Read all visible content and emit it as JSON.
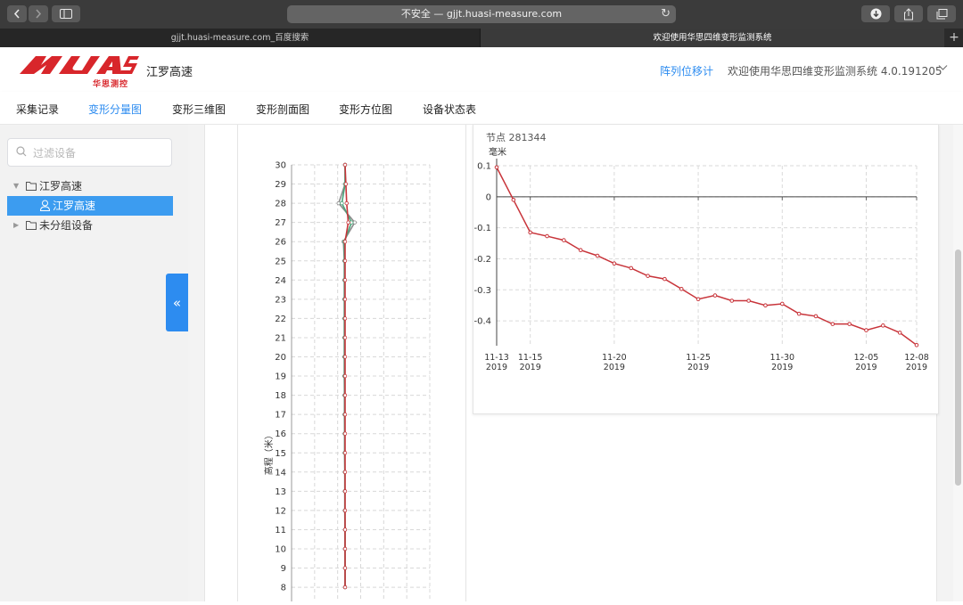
{
  "browser": {
    "address": "不安全 — gjjt.huasi-measure.com",
    "tabs": [
      "gjjt.huasi-measure.com_百度搜索",
      "欢迎使用华思四维变形监测系统"
    ]
  },
  "header": {
    "logo_text": "华思测控",
    "project": "江罗高速",
    "module": "阵列位移计",
    "welcome": "欢迎使用华思四维变形监测系统 4.0.191205"
  },
  "menu": [
    "采集记录",
    "变形分量图",
    "变形三维图",
    "变形剖面图",
    "变形方位图",
    "设备状态表"
  ],
  "menu_active": 1,
  "sidebar": {
    "search_placeholder": "过滤设备",
    "tree": [
      {
        "label": "江罗高速"
      },
      {
        "label": "江罗高速"
      },
      {
        "label": "未分组设备"
      }
    ],
    "collapse_label": "«"
  },
  "colors": {
    "accent": "#2d8cf0",
    "series": "#c8343a",
    "brand_red": "#d8262b"
  },
  "node_title": "节点 281344",
  "chart_data": [
    {
      "type": "line",
      "ylabel": "高程（米）",
      "y_ticks": [
        8,
        9,
        10,
        11,
        12,
        13,
        14,
        15,
        16,
        17,
        18,
        19,
        20,
        21,
        22,
        23,
        24,
        25,
        26,
        27,
        28,
        29,
        30
      ],
      "elevations": [
        30,
        29,
        28,
        27,
        26,
        25,
        24,
        23,
        22,
        21,
        20,
        19,
        18,
        17,
        16,
        15,
        14,
        13,
        12,
        11,
        10,
        9,
        8
      ],
      "series": [
        {
          "values": [
            0.0,
            0.0,
            -0.4,
            0.6,
            -0.1,
            -0.05,
            -0.05,
            -0.05,
            -0.05,
            -0.05,
            -0.05,
            -0.05,
            -0.04,
            -0.04,
            -0.03,
            -0.03,
            -0.02,
            -0.02,
            -0.02,
            -0.01,
            -0.01,
            0.0,
            0.0
          ]
        },
        {
          "values": [
            0.0,
            0.0,
            -0.2,
            0.4,
            -0.05,
            -0.03,
            -0.03,
            -0.03,
            -0.03,
            -0.03,
            -0.03,
            -0.03,
            -0.02,
            -0.02,
            -0.02,
            -0.02,
            -0.01,
            -0.01,
            -0.01,
            0.0,
            0.0,
            0.0,
            0.0
          ]
        },
        {
          "values": [
            0.0,
            0.05,
            0.1,
            0.2,
            0.0,
            0.0,
            0.0,
            0.0,
            0.0,
            0.0,
            0.0,
            0.0,
            0.0,
            0.0,
            0.0,
            0.0,
            0.0,
            0.0,
            0.0,
            0.0,
            0.0,
            0.0,
            0.0
          ]
        }
      ],
      "xlim": [
        -1.0,
        2.0
      ],
      "ylim": [
        8,
        30
      ]
    },
    {
      "type": "line",
      "ylabel": "毫米",
      "y_ticks": [
        0.1,
        0,
        -0.1,
        -0.2,
        -0.3,
        -0.4
      ],
      "ylim": [
        -0.48,
        0.1
      ],
      "x_ticks": [
        "11-13\n2019",
        "11-15\n2019",
        "11-20\n2019",
        "11-25\n2019",
        "11-30\n2019",
        "12-05\n2019",
        "12-08\n2019"
      ],
      "x_tick_days": [
        0,
        2,
        7,
        12,
        17,
        22,
        25
      ],
      "series": [
        {
          "x_days": [
            0,
            1,
            2,
            3,
            4,
            5,
            6,
            7,
            8,
            9,
            10,
            11,
            12,
            13,
            14,
            15,
            16,
            17,
            18,
            19,
            20,
            21,
            22,
            23,
            24,
            25
          ],
          "values": [
            0.095,
            -0.01,
            -0.115,
            -0.127,
            -0.14,
            -0.172,
            -0.19,
            -0.215,
            -0.23,
            -0.255,
            -0.265,
            -0.297,
            -0.33,
            -0.318,
            -0.335,
            -0.335,
            -0.35,
            -0.345,
            -0.377,
            -0.385,
            -0.41,
            -0.41,
            -0.43,
            -0.415,
            -0.438,
            -0.478
          ]
        }
      ]
    }
  ]
}
